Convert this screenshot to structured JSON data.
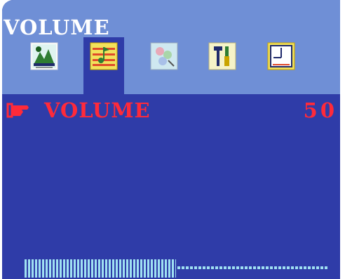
{
  "menu": {
    "title": "VOLUME",
    "tabs": [
      {
        "icon": "picture-icon",
        "active": false
      },
      {
        "icon": "audio-icon",
        "active": true
      },
      {
        "icon": "color-icon",
        "active": false
      },
      {
        "icon": "tools-icon",
        "active": false
      },
      {
        "icon": "timer-icon",
        "active": false
      }
    ]
  },
  "setting": {
    "label": "VOLUME",
    "value": "50",
    "level": 0.5
  },
  "colors": {
    "background": "#2f3ca8",
    "tabbar": "#6f8fd6",
    "highlight_text": "#ff2a3a",
    "slider": "#9fe0f2"
  }
}
